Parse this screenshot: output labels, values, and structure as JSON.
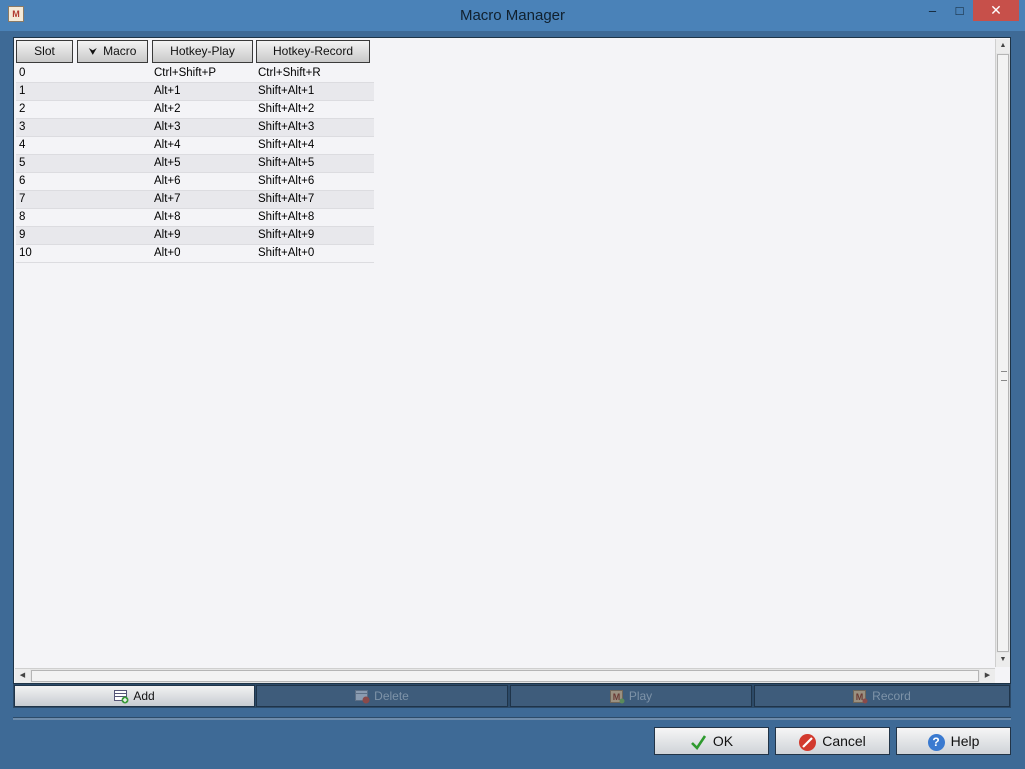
{
  "window": {
    "title": "Macro Manager",
    "app_icon": "M",
    "minimize_glyph": "–",
    "maximize_glyph": "□",
    "close_glyph": "✕"
  },
  "table": {
    "columns": [
      "Slot",
      "Macro",
      "Hotkey-Play",
      "Hotkey-Record"
    ],
    "sort_indicator": "⮟",
    "rows": [
      {
        "slot": "0",
        "macro": "",
        "play": "Ctrl+Shift+P",
        "record": "Ctrl+Shift+R"
      },
      {
        "slot": "1",
        "macro": "",
        "play": "Alt+1",
        "record": "Shift+Alt+1"
      },
      {
        "slot": "2",
        "macro": "",
        "play": "Alt+2",
        "record": "Shift+Alt+2"
      },
      {
        "slot": "3",
        "macro": "",
        "play": "Alt+3",
        "record": "Shift+Alt+3"
      },
      {
        "slot": "4",
        "macro": "",
        "play": "Alt+4",
        "record": "Shift+Alt+4"
      },
      {
        "slot": "5",
        "macro": "",
        "play": "Alt+5",
        "record": "Shift+Alt+5"
      },
      {
        "slot": "6",
        "macro": "",
        "play": "Alt+6",
        "record": "Shift+Alt+6"
      },
      {
        "slot": "7",
        "macro": "",
        "play": "Alt+7",
        "record": "Shift+Alt+7"
      },
      {
        "slot": "8",
        "macro": "",
        "play": "Alt+8",
        "record": "Shift+Alt+8"
      },
      {
        "slot": "9",
        "macro": "",
        "play": "Alt+9",
        "record": "Shift+Alt+9"
      },
      {
        "slot": "10",
        "macro": "",
        "play": "Alt+0",
        "record": "Shift+Alt+0"
      }
    ]
  },
  "toolbar": {
    "add_label": "Add",
    "delete_label": "Delete",
    "play_label": "Play",
    "record_label": "Record"
  },
  "dialog": {
    "ok_label": "OK",
    "cancel_label": "Cancel",
    "help_label": "Help"
  },
  "colors": {
    "window_bg": "#3e6a96",
    "titlebar": "#4a82b8",
    "close": "#c7504a",
    "content_bg": "#f4f4f7",
    "disabled_button": "#3e5c7b"
  },
  "icons": {
    "add": "add-table-icon",
    "delete": "delete-table-icon",
    "play": "macro-play-icon",
    "record": "macro-record-icon",
    "ok": "checkmark-icon",
    "cancel": "cancel-icon",
    "help": "help-icon"
  }
}
